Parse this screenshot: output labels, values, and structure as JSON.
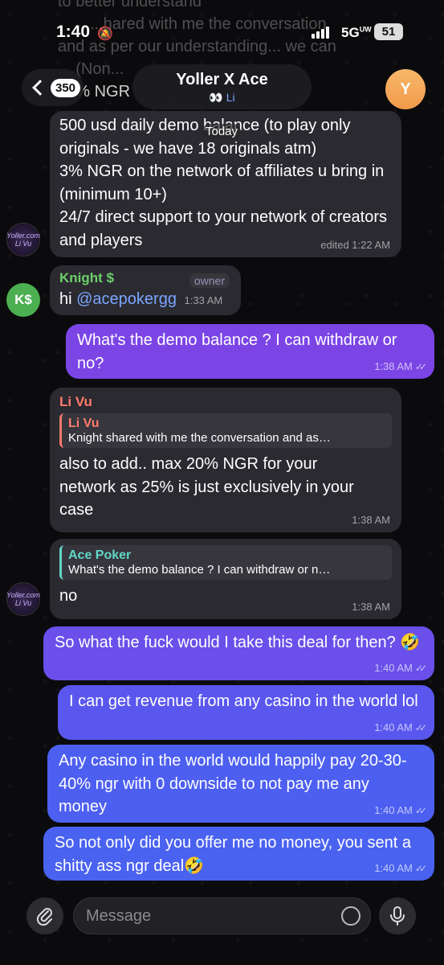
{
  "status": {
    "time": "1:40",
    "network": "5G",
    "network_sup": "UW",
    "battery": "51"
  },
  "header": {
    "back_count": "350",
    "title": "Yoller X Ace",
    "subtitle": "👀 Li",
    "avatar_letter": "Y"
  },
  "top_overlay": {
    "line1": "to better understand",
    "line2": "...hared with me the conversation",
    "line3": "and as per our understanding... we can",
    "line4": "... (Non...",
    "line5": "25% NGR"
  },
  "date_label": "Today",
  "messages": {
    "m1": {
      "lines": [
        "500 usd daily demo balance (to play only originals - we have 18 originals atm)",
        "3% NGR on the network of affiliates u bring in (minimum 10+)",
        "24/7 direct support to your network of creators and players"
      ],
      "time": "edited 1:22 AM"
    },
    "m2": {
      "sender": "Knight $",
      "badge": "owner",
      "prefix": "hi ",
      "mention": "@acepokergg",
      "time": "1:33 AM",
      "avatar": "K$"
    },
    "m3": {
      "text": "What's the demo balance ? I can withdraw or no?",
      "time": "1:38 AM"
    },
    "m4": {
      "sender": "Li Vu",
      "reply_name": "Li Vu",
      "reply_text": "Knight shared with me the conversation and as…",
      "text": "also to add.. max 20% NGR for your network as 25% is just exclusively in your case",
      "time": "1:38 AM"
    },
    "m5": {
      "reply_name": "Ace Poker",
      "reply_text": "What's the demo balance ? I can withdraw or n…",
      "text": "no",
      "time": "1:38 AM",
      "avatar_text": "Yoller.com Li Vu"
    },
    "m6": {
      "text": "So what the fuck would I take this deal for then? 🤣",
      "time": "1:40 AM"
    },
    "m7": {
      "text": "I can get revenue from any casino in the world lol",
      "time": "1:40 AM"
    },
    "m8": {
      "text": "Any casino in the world would happily pay 20-30-40% ngr with 0 downside to not pay me any money",
      "time": "1:40 AM"
    },
    "m9": {
      "text": "So not only did you offer me no money, you sent a shitty ass ngr deal🤣",
      "time": "1:40 AM"
    }
  },
  "input": {
    "placeholder": "Message"
  },
  "colors": {
    "incoming": "#2b2a31",
    "outgoing_purple": "#7b45e6",
    "outgoing_blue": "#4a62f0",
    "link": "#7aa7ff"
  }
}
